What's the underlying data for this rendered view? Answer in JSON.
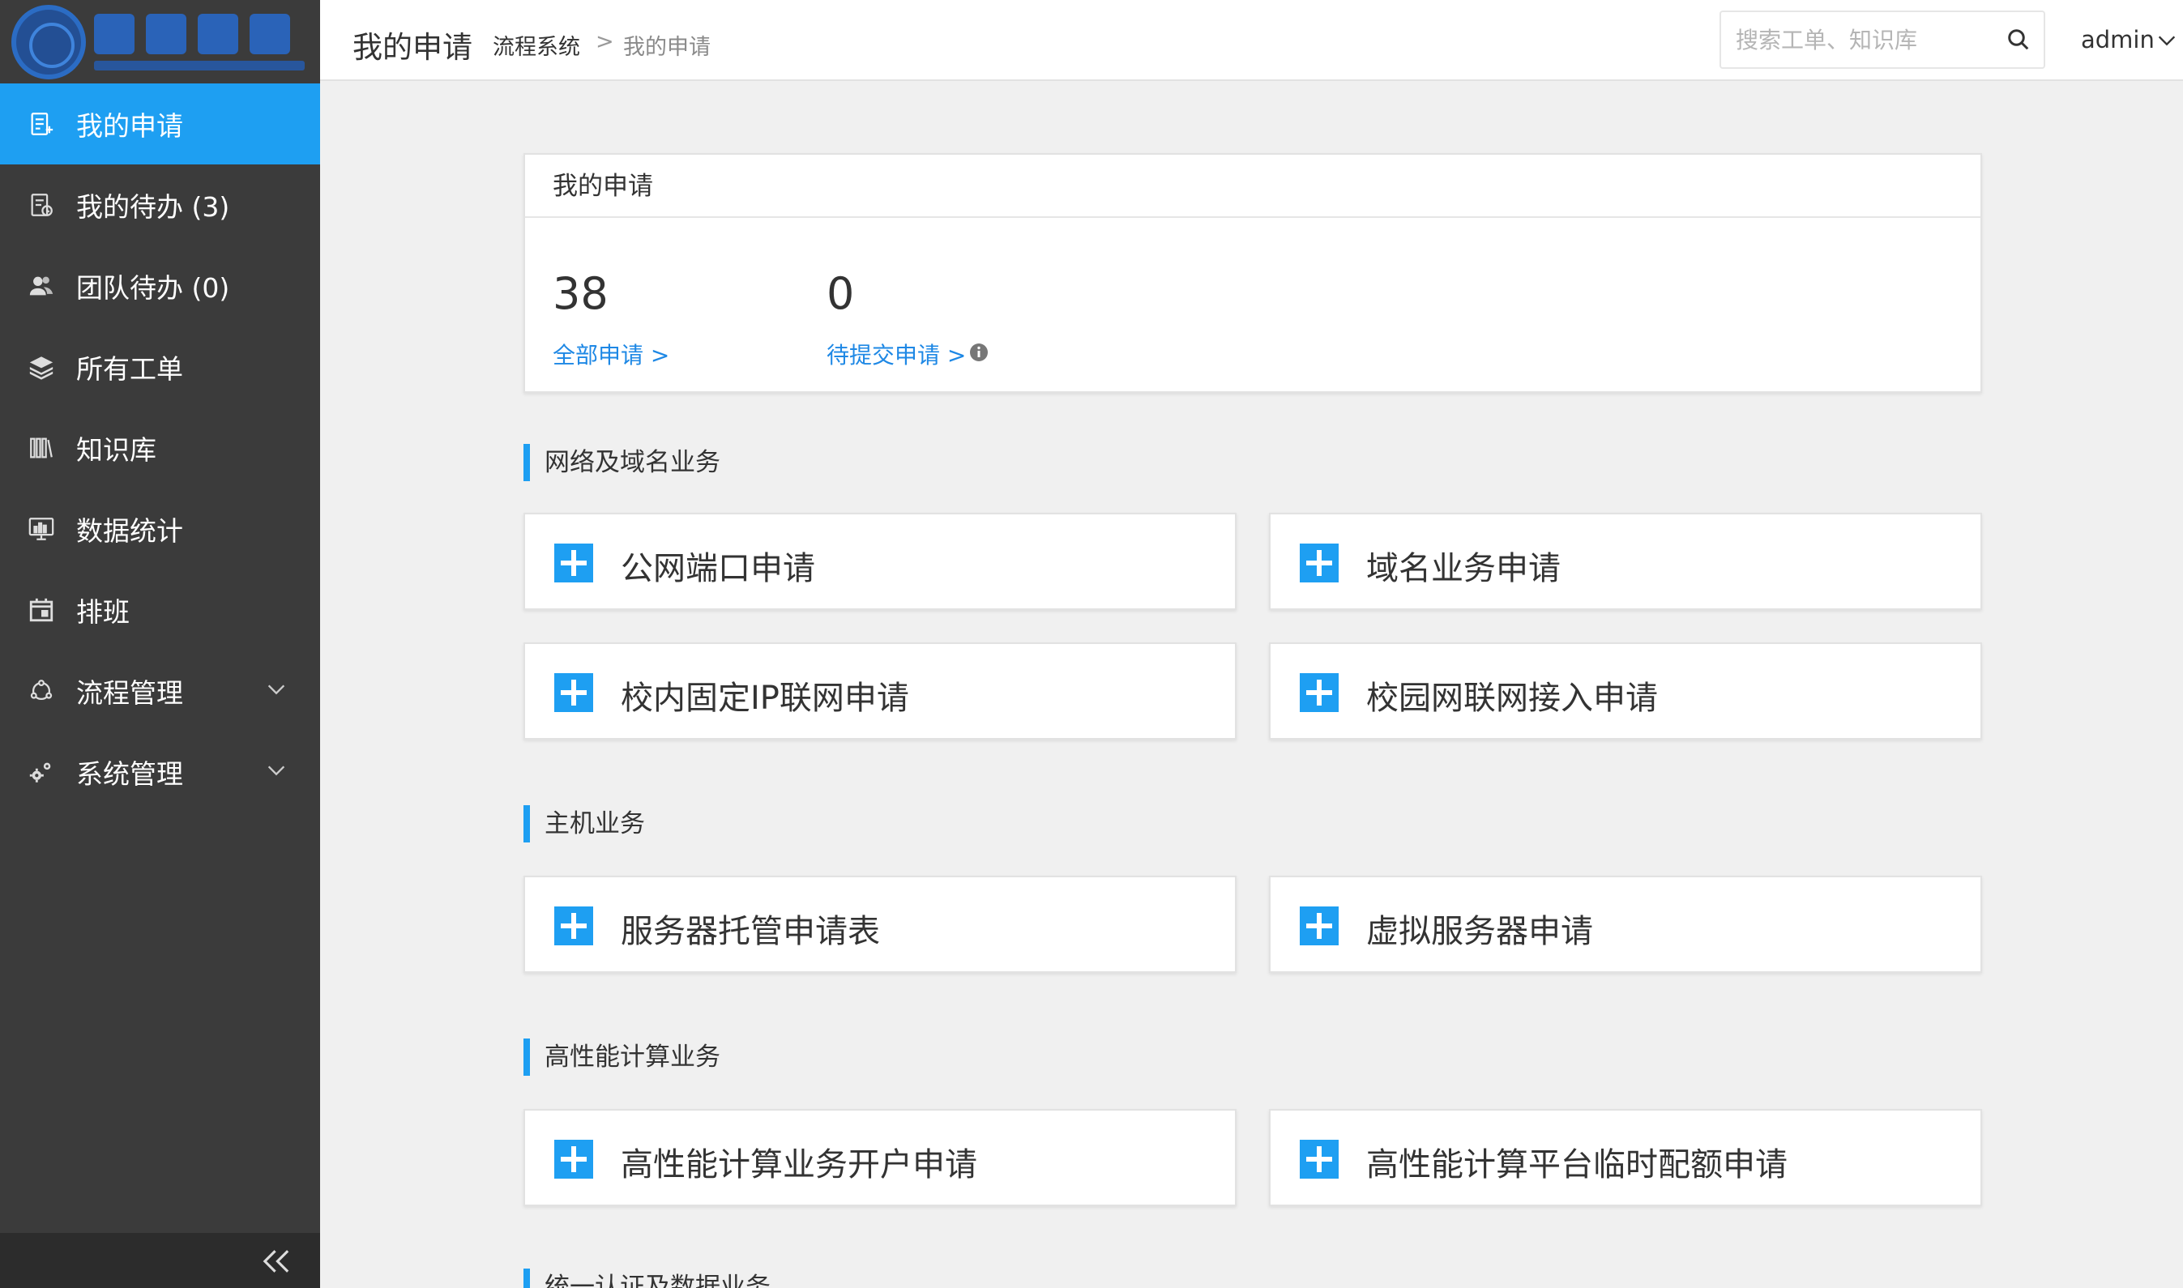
{
  "sidebar": {
    "items": [
      {
        "label": "我的申请",
        "icon": "form-icon"
      },
      {
        "label": "我的待办 (3)",
        "icon": "todo-icon"
      },
      {
        "label": "团队待办 (0)",
        "icon": "team-icon"
      },
      {
        "label": "所有工单",
        "icon": "layers-icon"
      },
      {
        "label": "知识库",
        "icon": "books-icon"
      },
      {
        "label": "数据统计",
        "icon": "monitor-chart-icon"
      },
      {
        "label": "排班",
        "icon": "calendar-icon"
      },
      {
        "label": "流程管理",
        "icon": "process-icon"
      },
      {
        "label": "系统管理",
        "icon": "gears-icon"
      }
    ]
  },
  "header": {
    "title": "我的申请",
    "breadcrumb": [
      "流程系统",
      ">",
      "我的申请"
    ],
    "search_placeholder": "搜索工单、知识库",
    "user": "admin"
  },
  "summary": {
    "title": "我的申请",
    "stats": [
      {
        "value": "38",
        "link": "全部申请 >"
      },
      {
        "value": "0",
        "link": "待提交申请 >"
      }
    ]
  },
  "sections": [
    {
      "title": "网络及域名业务",
      "items": [
        "公网端口申请",
        "域名业务申请",
        "校内固定IP联网申请",
        "校园网联网接入申请"
      ]
    },
    {
      "title": "主机业务",
      "items": [
        "服务器托管申请表",
        "虚拟服务器申请"
      ]
    },
    {
      "title": "高性能计算业务",
      "items": [
        "高性能计算业务开户申请",
        "高性能计算平台临时配额申请"
      ]
    },
    {
      "title": "统一认证及数据业务"
    }
  ],
  "colors": {
    "accent": "#1e9ff2",
    "sidebar_bg": "#3b3b3b",
    "link": "#1e88e5"
  }
}
